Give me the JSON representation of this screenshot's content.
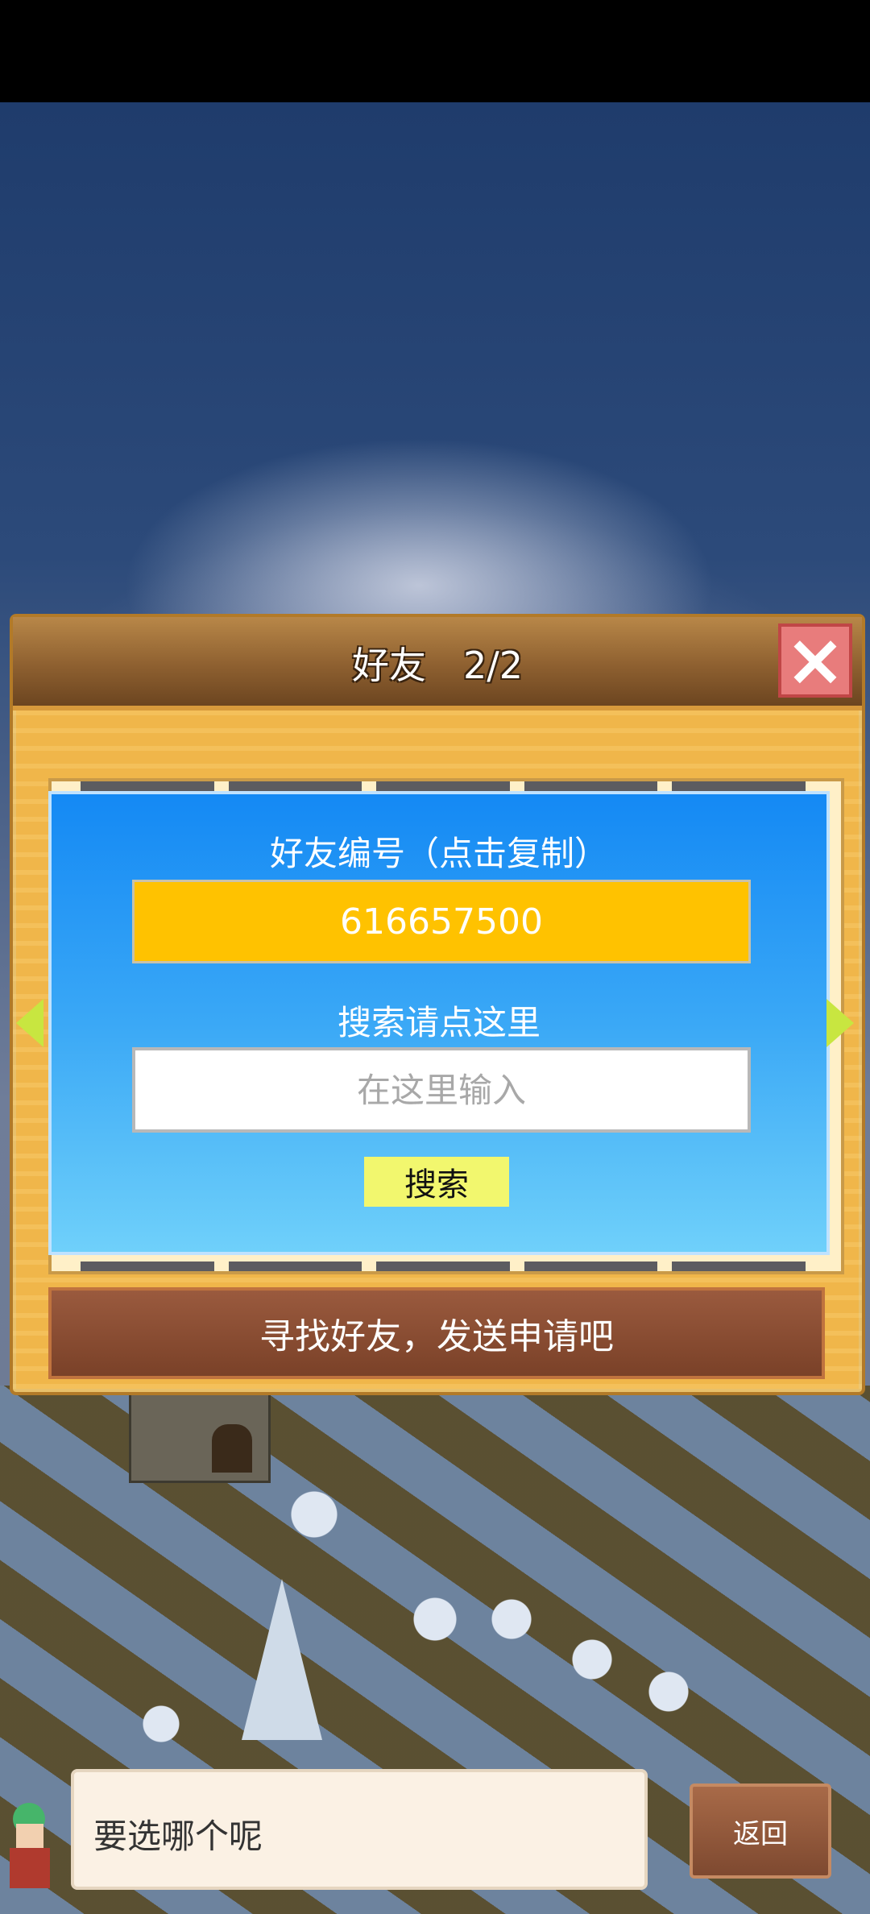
{
  "dialog": {
    "title": "好友　2/2",
    "close_icon": "×"
  },
  "friend_card": {
    "id_label": "好友编号（点击复制）",
    "friend_id": "616657500",
    "search_hint": "搜索请点这里",
    "search_placeholder": "在这里输入",
    "search_value": "",
    "search_button_label": "搜索"
  },
  "navigation": {
    "prev_icon": "triangle-left-icon",
    "next_icon": "triangle-right-icon"
  },
  "find_friend_button_label": "寻找好友，发送申请吧",
  "bottom_bar": {
    "speech_text": "要选哪个呢",
    "back_label": "返回"
  },
  "colors": {
    "header_brown": "#8e6030",
    "panel_blue": "#1489f4",
    "id_box_yellow": "#ffc200",
    "search_button_yellow": "#f2f76e",
    "close_red": "#e87c7c",
    "arrow_green": "#c8e640"
  }
}
